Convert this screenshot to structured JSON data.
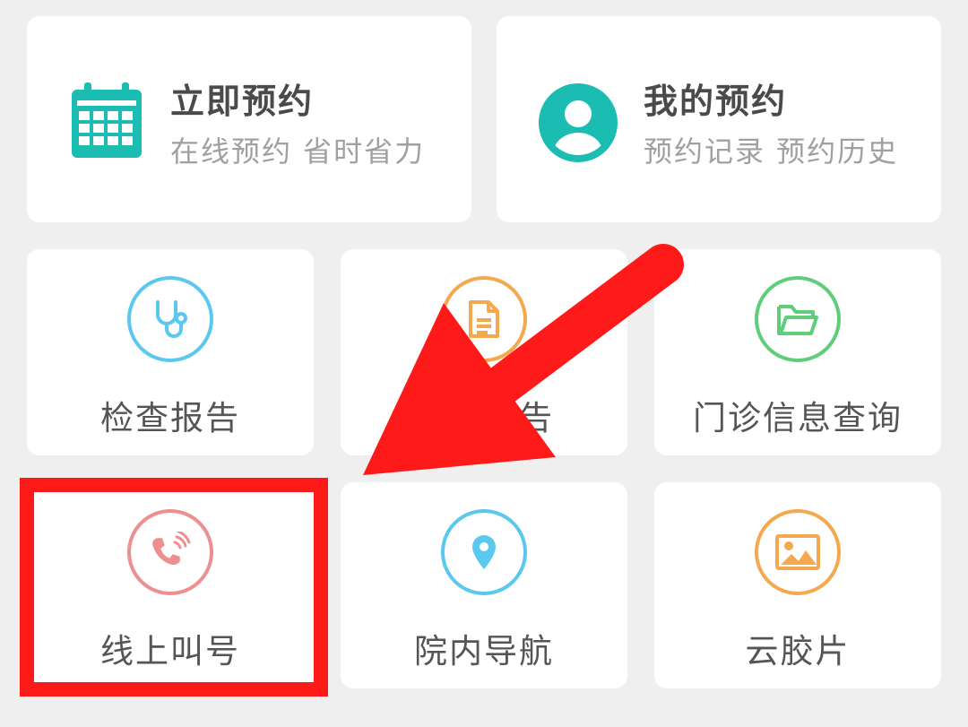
{
  "primary_cards": [
    {
      "title": "立即预约",
      "subtitle": "在线预约 省时省力",
      "icon": "calendar-icon"
    },
    {
      "title": "我的预约",
      "subtitle": "预约记录 预约历史",
      "icon": "user-avatar-icon"
    }
  ],
  "tiles": [
    {
      "label": "检查报告",
      "icon": "stethoscope-icon",
      "color": "#5bc8ef"
    },
    {
      "label": "检验报告",
      "icon": "document-icon",
      "color": "#f4a94e"
    },
    {
      "label": "门诊信息查询",
      "icon": "folder-icon",
      "color": "#5fcd79"
    },
    {
      "label": "线上叫号",
      "icon": "phone-call-icon",
      "color": "#ee8f8f"
    },
    {
      "label": "院内导航",
      "icon": "location-pin-icon",
      "color": "#5bc8ef"
    },
    {
      "label": "云胶片",
      "icon": "image-icon",
      "color": "#f4a94e"
    }
  ],
  "colors": {
    "teal": "#1bbcb1",
    "highlight_red": "#ff1a1a",
    "background": "#efefef"
  },
  "annotation": {
    "type": "red arrow and box highlighting",
    "target": "线上叫号"
  }
}
